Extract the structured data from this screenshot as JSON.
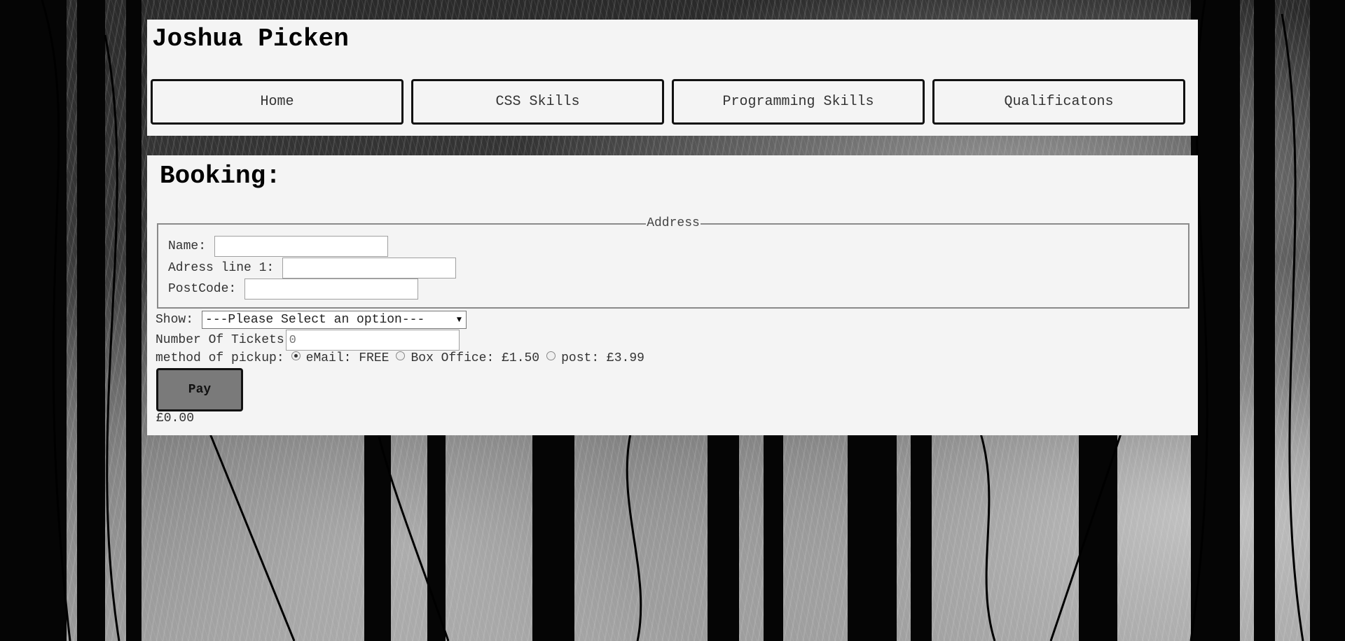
{
  "header": {
    "title": "Joshua Picken",
    "nav": [
      {
        "label": "Home"
      },
      {
        "label": "CSS Skills"
      },
      {
        "label": "Programming Skills"
      },
      {
        "label": "Qualificatons"
      }
    ]
  },
  "booking": {
    "title": "Booking:",
    "address": {
      "legend": "Address",
      "name_label": "Name:",
      "name_value": "",
      "line1_label": "Adress line 1:",
      "line1_value": "",
      "postcode_label": "PostCode:",
      "postcode_value": ""
    },
    "show": {
      "label": "Show:",
      "selected": "---Please Select an option---"
    },
    "tickets": {
      "label": "Number Of Tickets",
      "placeholder": "0"
    },
    "pickup": {
      "label": "method of pickup:",
      "options": [
        {
          "label": "eMail: FREE",
          "checked": true
        },
        {
          "label": "Box Office: £1.50",
          "checked": false
        },
        {
          "label": "post: £3.99",
          "checked": false
        }
      ]
    },
    "pay_label": "Pay",
    "total": "£0.00"
  },
  "colors": {
    "panel": "#f4f4f4",
    "button": "#7a7a7a",
    "border": "#111111"
  }
}
